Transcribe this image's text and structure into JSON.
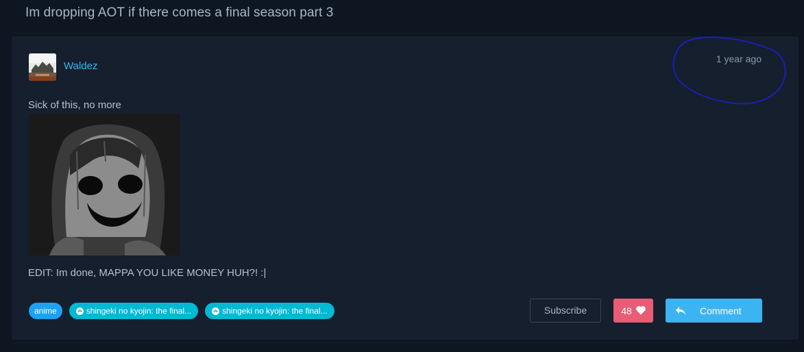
{
  "thread": {
    "title": "Im dropping AOT if there comes a final season part 3"
  },
  "post": {
    "author": "Waldez",
    "time": "1 year ago",
    "body": "Sick of this, no more",
    "edit": "EDIT: Im done, MAPPA YOU LIKE MONEY HUH?! :|",
    "image_icon": "creepy-face-image"
  },
  "tags": [
    {
      "label": "anime"
    },
    {
      "label": "shingeki no kyojin: the final..."
    },
    {
      "label": "shingeki no kyojin: the final..."
    }
  ],
  "actions": {
    "subscribe": "Subscribe",
    "likes": "48",
    "comment": "Comment"
  },
  "colors": {
    "background": "#0d1621",
    "card": "#151f2e",
    "accent": "#3db4f2",
    "like": "#e85d75",
    "tag": "#00b9d4",
    "annotation": "#1d1fb3"
  }
}
